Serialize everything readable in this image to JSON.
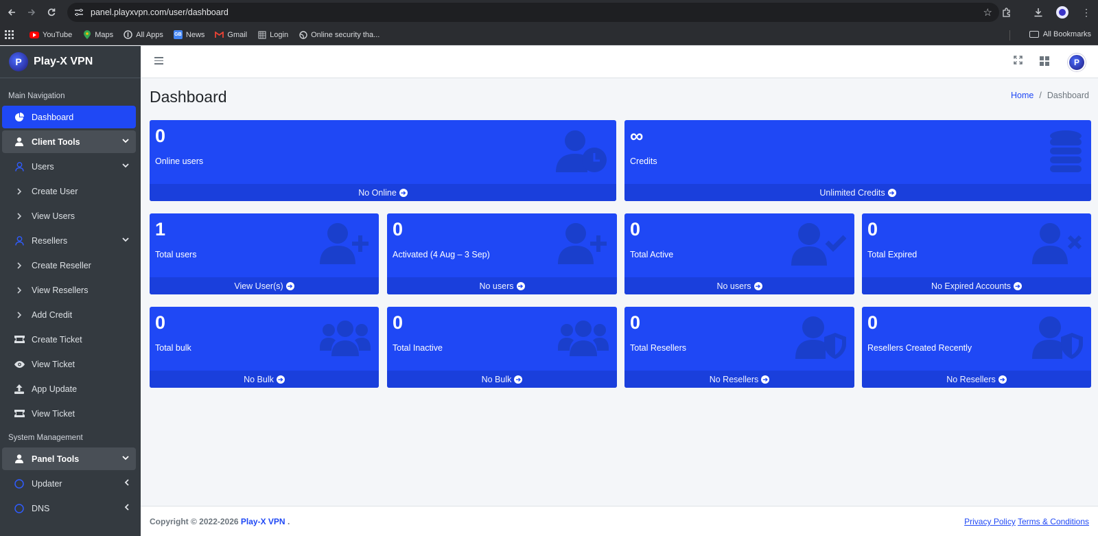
{
  "browser": {
    "url": "panel.playxvpn.com/user/dashboard",
    "bookmarks": [
      {
        "label": "YouTube",
        "icon": "youtube-icon",
        "color": "#ff0000"
      },
      {
        "label": "Maps",
        "icon": "maps-icon",
        "color": "#34a853"
      },
      {
        "label": "All Apps",
        "icon": "apps-icon",
        "color": "#cfd2d6"
      },
      {
        "label": "News",
        "icon": "news-icon",
        "color": "#4285f4"
      },
      {
        "label": "Gmail",
        "icon": "gmail-icon",
        "color": "#ea4335"
      },
      {
        "label": "Login",
        "icon": "login-icon",
        "color": "#cfd2d6"
      },
      {
        "label": "Online security tha...",
        "icon": "globe-icon",
        "color": "#cfd2d6"
      }
    ],
    "all_bookmarks": "All Bookmarks"
  },
  "brand": {
    "name": "Play-X VPN",
    "logo_letter": "P"
  },
  "sidebar": {
    "main_header": "Main Navigation",
    "system_header": "System Management",
    "items": [
      {
        "label": "Dashboard",
        "icon": "dashboard-icon"
      },
      {
        "label": "Client Tools",
        "icon": "user-icon"
      },
      {
        "label": "Users",
        "icon": "user-outline-icon"
      },
      {
        "label": "Create User",
        "icon": "chevron-right-icon"
      },
      {
        "label": "View Users",
        "icon": "chevron-right-icon"
      },
      {
        "label": "Resellers",
        "icon": "user-outline-icon"
      },
      {
        "label": "Create Reseller",
        "icon": "chevron-right-icon"
      },
      {
        "label": "View Resellers",
        "icon": "chevron-right-icon"
      },
      {
        "label": "Add Credit",
        "icon": "chevron-right-icon"
      },
      {
        "label": "Create Ticket",
        "icon": "ticket-icon"
      },
      {
        "label": "View Ticket",
        "icon": "eye-icon"
      },
      {
        "label": "App Update",
        "icon": "upload-icon"
      },
      {
        "label": "View Ticket",
        "icon": "ticket-icon"
      },
      {
        "label": "Panel Tools",
        "icon": "user-icon"
      },
      {
        "label": "Updater",
        "icon": "circle-icon"
      },
      {
        "label": "DNS",
        "icon": "circle-icon"
      }
    ]
  },
  "page": {
    "title": "Dashboard"
  },
  "breadcrumb": {
    "home": "Home",
    "separator": "/",
    "current": "Dashboard"
  },
  "cards": {
    "online": {
      "value": "0",
      "label": "Online users",
      "footer": "No Online"
    },
    "credits": {
      "value": "∞",
      "label": "Credits",
      "footer": "Unlimited Credits"
    },
    "total_users": {
      "value": "1",
      "label": "Total users",
      "footer": "View User(s)"
    },
    "activated": {
      "value": "0",
      "label": "Activated (4 Aug – 3 Sep)",
      "footer": "No users"
    },
    "total_active": {
      "value": "0",
      "label": "Total Active",
      "footer": "No users"
    },
    "total_expired": {
      "value": "0",
      "label": "Total Expired",
      "footer": "No Expired Accounts"
    },
    "total_bulk": {
      "value": "0",
      "label": "Total bulk",
      "footer": "No Bulk"
    },
    "total_inactive": {
      "value": "0",
      "label": "Total Inactive",
      "footer": "No Bulk"
    },
    "total_resellers": {
      "value": "0",
      "label": "Total Resellers",
      "footer": "No Resellers"
    },
    "resellers_recent": {
      "value": "0",
      "label": "Resellers Created Recently",
      "footer": "No Resellers"
    }
  },
  "footer": {
    "copyright": "Copyright © 2022-2026",
    "brand": "Play-X VPN",
    "dot": ".",
    "privacy": "Privacy Policy",
    "terms": "Terms & Conditions"
  },
  "colors": {
    "accent": "#1f48f5",
    "sidebar": "#343a40"
  }
}
